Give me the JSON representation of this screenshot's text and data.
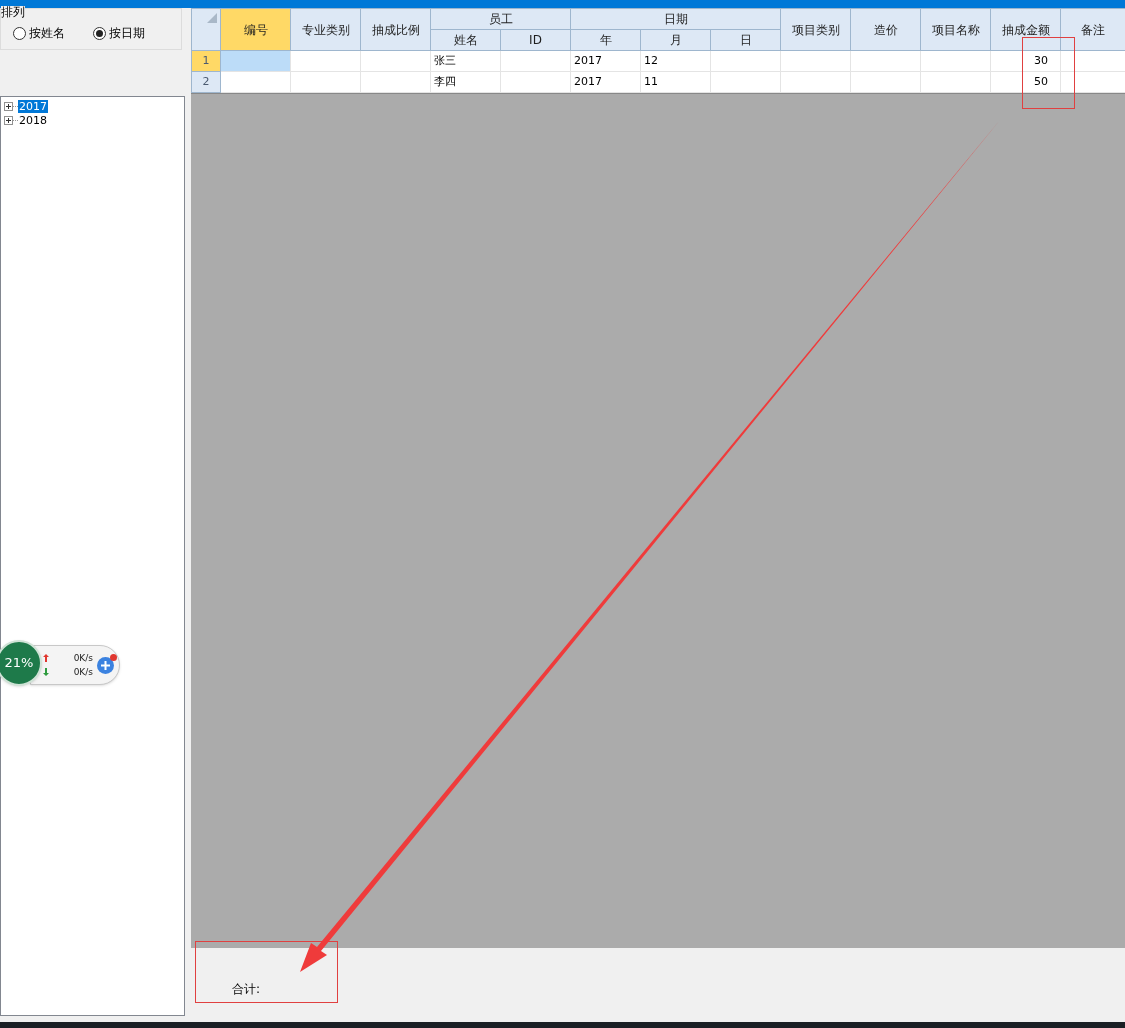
{
  "sort_group": {
    "title": "排列",
    "options": [
      {
        "label": "按姓名",
        "selected": false
      },
      {
        "label": "按日期",
        "selected": true
      }
    ]
  },
  "tree": {
    "items": [
      {
        "label": "2017",
        "selected": true,
        "expanded": false
      },
      {
        "label": "2018",
        "selected": false,
        "expanded": false
      }
    ]
  },
  "table": {
    "columns": [
      {
        "label": "编号",
        "selected": true
      },
      {
        "label": "专业类别",
        "selected": false
      },
      {
        "label": "抽成比例",
        "selected": false
      },
      {
        "label": "员工",
        "colspan": 2,
        "children": [
          {
            "label": "姓名",
            "selected": false,
            "kind": "text"
          },
          {
            "label": "ID",
            "selected": false
          }
        ]
      },
      {
        "label": "日期",
        "colspan": 3,
        "children": [
          {
            "label": "年",
            "selected": false,
            "kind": "text"
          },
          {
            "label": "月",
            "selected": false,
            "kind": "text"
          },
          {
            "label": "日",
            "selected": false
          }
        ]
      },
      {
        "label": "项目类别",
        "selected": false
      },
      {
        "label": "造价",
        "selected": false
      },
      {
        "label": "项目名称",
        "selected": false
      },
      {
        "label": "抽成金额",
        "selected": false,
        "kind": "number"
      },
      {
        "label": "备注",
        "selected": false
      }
    ],
    "rows": [
      {
        "number": "1",
        "selected": true,
        "cells": [
          null,
          null,
          null,
          "张三",
          null,
          "2017",
          "12",
          null,
          null,
          null,
          null,
          "30",
          null
        ]
      },
      {
        "number": "2",
        "selected": false,
        "cells": [
          null,
          null,
          null,
          "李四",
          null,
          "2017",
          "11",
          null,
          null,
          null,
          null,
          "50",
          null
        ]
      }
    ]
  },
  "footer": {
    "total_label": "合计:"
  },
  "net_widget": {
    "percent": "21%",
    "upload": "0K/s",
    "download": "0K/s"
  }
}
